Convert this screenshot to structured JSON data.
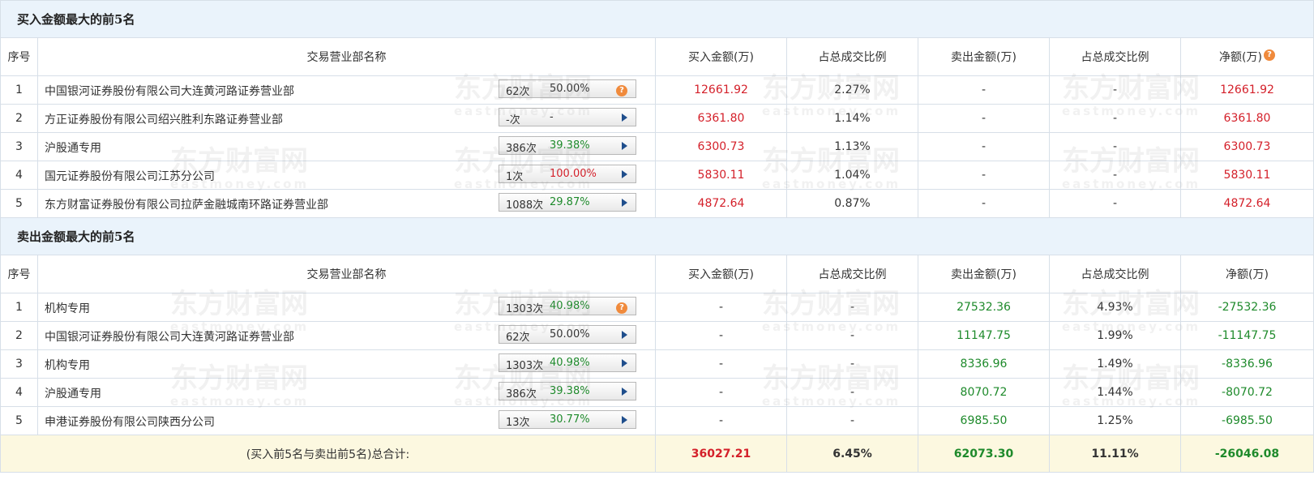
{
  "buy_section": {
    "title": "买入金额最大的前5名",
    "headers": [
      "序号",
      "交易营业部名称",
      "买入金额(万)",
      "占总成交比例",
      "卖出金额(万)",
      "占总成交比例",
      "净额(万)"
    ],
    "rows": [
      {
        "idx": "1",
        "name": "中国银河证券股份有限公司大连黄河路证券营业部",
        "times": "62次",
        "pct": "50.00%",
        "pct_color": "dark",
        "icon": "question",
        "buy": "12661.92",
        "buy_ratio": "2.27%",
        "sell": "-",
        "sell_ratio": "-",
        "net": "12661.92"
      },
      {
        "idx": "2",
        "name": "方正证券股份有限公司绍兴胜利东路证券营业部",
        "times": "-次",
        "pct": "-",
        "pct_color": "dark",
        "icon": "arrow",
        "buy": "6361.80",
        "buy_ratio": "1.14%",
        "sell": "-",
        "sell_ratio": "-",
        "net": "6361.80"
      },
      {
        "idx": "3",
        "name": "沪股通专用",
        "times": "386次",
        "pct": "39.38%",
        "pct_color": "green",
        "icon": "arrow",
        "buy": "6300.73",
        "buy_ratio": "1.13%",
        "sell": "-",
        "sell_ratio": "-",
        "net": "6300.73"
      },
      {
        "idx": "4",
        "name": "国元证券股份有限公司江苏分公司",
        "times": "1次",
        "pct": "100.00%",
        "pct_color": "red",
        "icon": "arrow",
        "buy": "5830.11",
        "buy_ratio": "1.04%",
        "sell": "-",
        "sell_ratio": "-",
        "net": "5830.11"
      },
      {
        "idx": "5",
        "name": "东方财富证券股份有限公司拉萨金融城南环路证券营业部",
        "times": "1088次",
        "pct": "29.87%",
        "pct_color": "green",
        "icon": "arrow",
        "buy": "4872.64",
        "buy_ratio": "0.87%",
        "sell": "-",
        "sell_ratio": "-",
        "net": "4872.64"
      }
    ]
  },
  "sell_section": {
    "title": "卖出金额最大的前5名",
    "headers": [
      "序号",
      "交易营业部名称",
      "买入金额(万)",
      "占总成交比例",
      "卖出金额(万)",
      "占总成交比例",
      "净额(万)"
    ],
    "rows": [
      {
        "idx": "1",
        "name": "机构专用",
        "times": "1303次",
        "pct": "40.98%",
        "pct_color": "green",
        "icon": "question",
        "buy": "-",
        "buy_ratio": "-",
        "sell": "27532.36",
        "sell_ratio": "4.93%",
        "net": "-27532.36"
      },
      {
        "idx": "2",
        "name": "中国银河证券股份有限公司大连黄河路证券营业部",
        "times": "62次",
        "pct": "50.00%",
        "pct_color": "dark",
        "icon": "arrow",
        "buy": "-",
        "buy_ratio": "-",
        "sell": "11147.75",
        "sell_ratio": "1.99%",
        "net": "-11147.75"
      },
      {
        "idx": "3",
        "name": "机构专用",
        "times": "1303次",
        "pct": "40.98%",
        "pct_color": "green",
        "icon": "arrow",
        "buy": "-",
        "buy_ratio": "-",
        "sell": "8336.96",
        "sell_ratio": "1.49%",
        "net": "-8336.96"
      },
      {
        "idx": "4",
        "name": "沪股通专用",
        "times": "386次",
        "pct": "39.38%",
        "pct_color": "green",
        "icon": "arrow",
        "buy": "-",
        "buy_ratio": "-",
        "sell": "8070.72",
        "sell_ratio": "1.44%",
        "net": "-8070.72"
      },
      {
        "idx": "5",
        "name": "申港证券股份有限公司陕西分公司",
        "times": "13次",
        "pct": "30.77%",
        "pct_color": "green",
        "icon": "arrow",
        "buy": "-",
        "buy_ratio": "-",
        "sell": "6985.50",
        "sell_ratio": "1.25%",
        "net": "-6985.50"
      }
    ]
  },
  "total": {
    "label": "(买入前5名与卖出前5名)总合计:",
    "buy": "36027.21",
    "buy_ratio": "6.45%",
    "sell": "62073.30",
    "sell_ratio": "11.11%",
    "net": "-26046.08"
  },
  "watermark": {
    "text": "东方财富网",
    "sub": "eastmoney.com"
  },
  "colors": {
    "red": "#d4202a",
    "green": "#1e8a2b",
    "header_bg": "#eaf3fb",
    "total_bg": "#fcf8e0",
    "border": "#d7dfe8"
  }
}
